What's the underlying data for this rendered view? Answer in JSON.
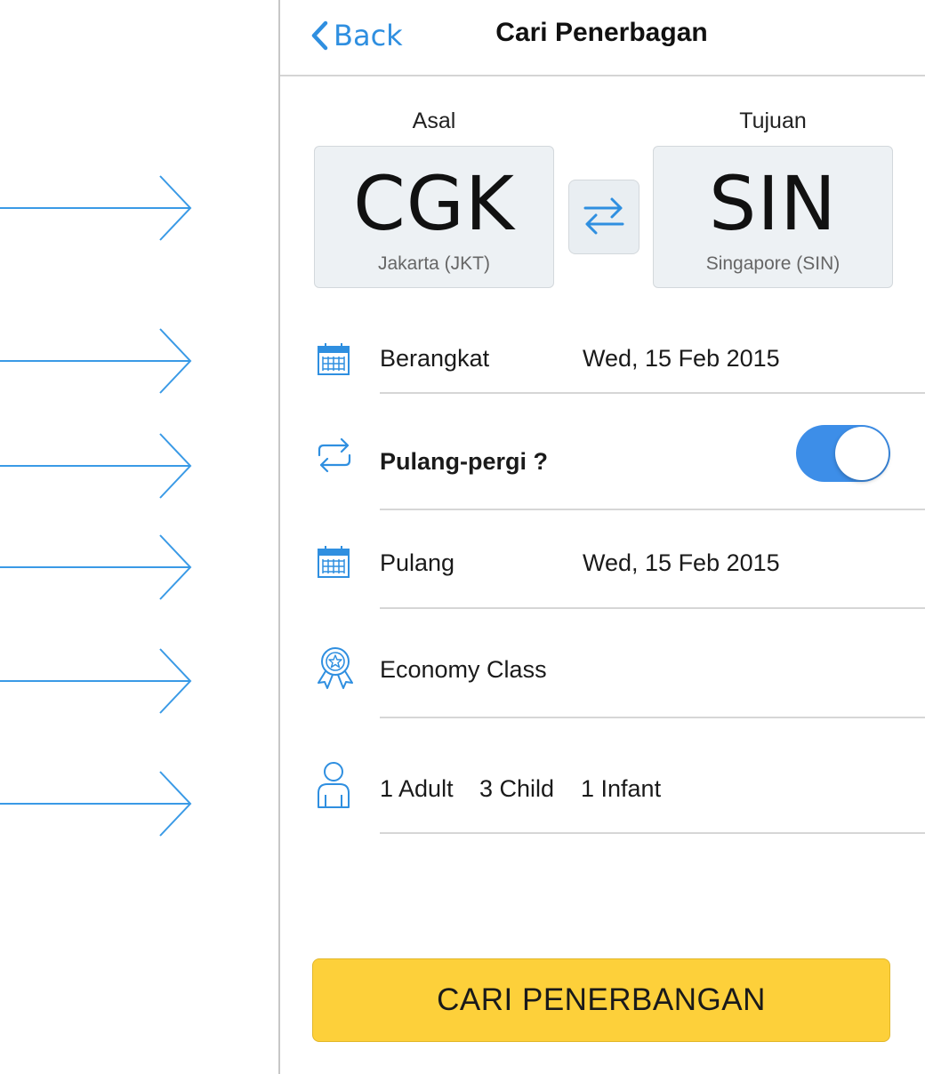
{
  "colors": {
    "accent": "#2f8fe0",
    "toggle_on": "#3d8ee8",
    "primary_button": "#fdd03a",
    "card_background": "#edf1f4"
  },
  "header": {
    "back_label": "Back",
    "title": "Cari Penerbagan"
  },
  "route": {
    "origin": {
      "label": "Asal",
      "code": "CGK",
      "city": "Jakarta (JKT)"
    },
    "destination": {
      "label": "Tujuan",
      "code": "SIN",
      "city": "Singapore (SIN)"
    },
    "swap_icon": "swap-arrows-icon"
  },
  "departure": {
    "icon": "calendar-icon",
    "label": "Berangkat",
    "value": "Wed, 15 Feb 2015"
  },
  "round_trip": {
    "icon": "repeat-icon",
    "label": "Pulang-pergi ?",
    "enabled": true
  },
  "return": {
    "icon": "calendar-icon",
    "label": "Pulang",
    "value": "Wed, 15 Feb 2015"
  },
  "cabin": {
    "icon": "award-ribbon-icon",
    "label": "Economy Class"
  },
  "passengers": {
    "icon": "person-icon",
    "adult": "1 Adult",
    "child": "3 Child",
    "infant": "1 Infant"
  },
  "search_button": "CARI PENERBANGAN",
  "annotation_arrows": 6
}
